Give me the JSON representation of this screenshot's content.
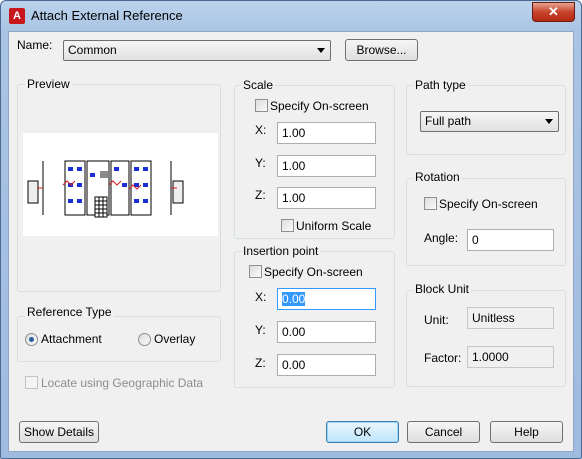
{
  "window": {
    "title": "Attach External Reference",
    "close_glyph": "✕",
    "app_icon_letter": "A"
  },
  "name_row": {
    "label": "Name:",
    "value": "Common",
    "browse_label": "Browse..."
  },
  "preview": {
    "title": "Preview"
  },
  "reference_type": {
    "title": "Reference Type",
    "attachment_label": "Attachment",
    "overlay_label": "Overlay",
    "selected": "Attachment"
  },
  "geo": {
    "label": "Locate using Geographic Data"
  },
  "scale": {
    "title": "Scale",
    "specify_label": "Specify On-screen",
    "x_label": "X:",
    "x_value": "1.00",
    "y_label": "Y:",
    "y_value": "1.00",
    "z_label": "Z:",
    "z_value": "1.00",
    "uniform_label": "Uniform Scale"
  },
  "insertion": {
    "title": "Insertion point",
    "specify_label": "Specify On-screen",
    "x_label": "X:",
    "x_value": "0.00",
    "y_label": "Y:",
    "y_value": "0.00",
    "z_label": "Z:",
    "z_value": "0.00"
  },
  "path_type": {
    "title": "Path type",
    "value": "Full path"
  },
  "rotation": {
    "title": "Rotation",
    "specify_label": "Specify On-screen",
    "angle_label": "Angle:",
    "angle_value": "0"
  },
  "block_unit": {
    "title": "Block Unit",
    "unit_label": "Unit:",
    "unit_value": "Unitless",
    "factor_label": "Factor:",
    "factor_value": "1.0000"
  },
  "footer": {
    "show_details": "Show Details",
    "ok": "OK",
    "cancel": "Cancel",
    "help": "Help"
  }
}
